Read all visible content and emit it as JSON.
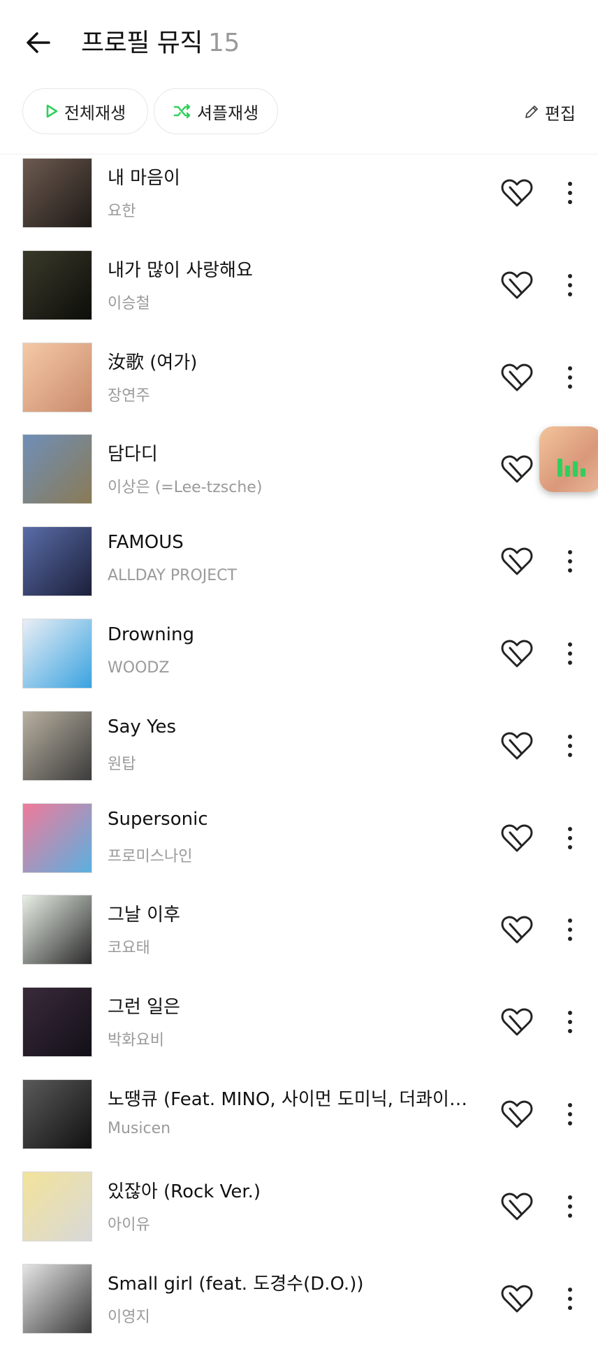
{
  "header": {
    "title": "프로필 뮤직",
    "count": "15"
  },
  "actions": {
    "play_all": "전체재생",
    "shuffle": "셔플재생",
    "edit": "편집"
  },
  "colors": {
    "accent_green": "#2fcf5b",
    "text_primary": "#111111",
    "text_secondary": "#9a9a9a"
  },
  "songs": [
    {
      "title": "내 마음이",
      "artist": "요한",
      "thumb": [
        "#6d5a50",
        "#1e1a17"
      ]
    },
    {
      "title": "내가 많이 사랑해요",
      "artist": "이승철",
      "thumb": [
        "#3a3a2a",
        "#0d0d0a"
      ]
    },
    {
      "title": "汝歌 (여가)",
      "artist": "장연주",
      "thumb": [
        "#f5c9a6",
        "#c98b6c"
      ]
    },
    {
      "title": "담다디",
      "artist": "이상은 (=Lee-tzsche)",
      "thumb": [
        "#6f8fb8",
        "#8a7a55"
      ]
    },
    {
      "title": "FAMOUS",
      "artist": "ALLDAY PROJECT",
      "thumb": [
        "#5a6da8",
        "#1b1f3a"
      ]
    },
    {
      "title": "Drowning",
      "artist": "WOODZ",
      "thumb": [
        "#e9eef5",
        "#3aa3e0"
      ]
    },
    {
      "title": "Say Yes",
      "artist": "원탑",
      "thumb": [
        "#b8b0a0",
        "#3c3c3c"
      ]
    },
    {
      "title": "Supersonic",
      "artist": "프로미스나인",
      "thumb": [
        "#f07a9a",
        "#5ab0e0"
      ]
    },
    {
      "title": "그날 이후",
      "artist": "코요태",
      "thumb": [
        "#e8efe6",
        "#2a2a2a"
      ]
    },
    {
      "title": "그런 일은",
      "artist": "박화요비",
      "thumb": [
        "#3a2a3a",
        "#121018"
      ]
    },
    {
      "title": "노땡큐 (Feat. MINO, 사이먼 도미닉, 더콰이엇)...",
      "artist": "Musicen",
      "thumb": [
        "#5a5a5a",
        "#111111"
      ]
    },
    {
      "title": "있잖아 (Rock Ver.)",
      "artist": "아이유",
      "thumb": [
        "#f3e39a",
        "#d8d8d8"
      ]
    },
    {
      "title": "Small girl (feat. 도경수(D.O.))",
      "artist": "이영지",
      "thumb": [
        "#e5e5e5",
        "#3a3a3a"
      ]
    }
  ]
}
